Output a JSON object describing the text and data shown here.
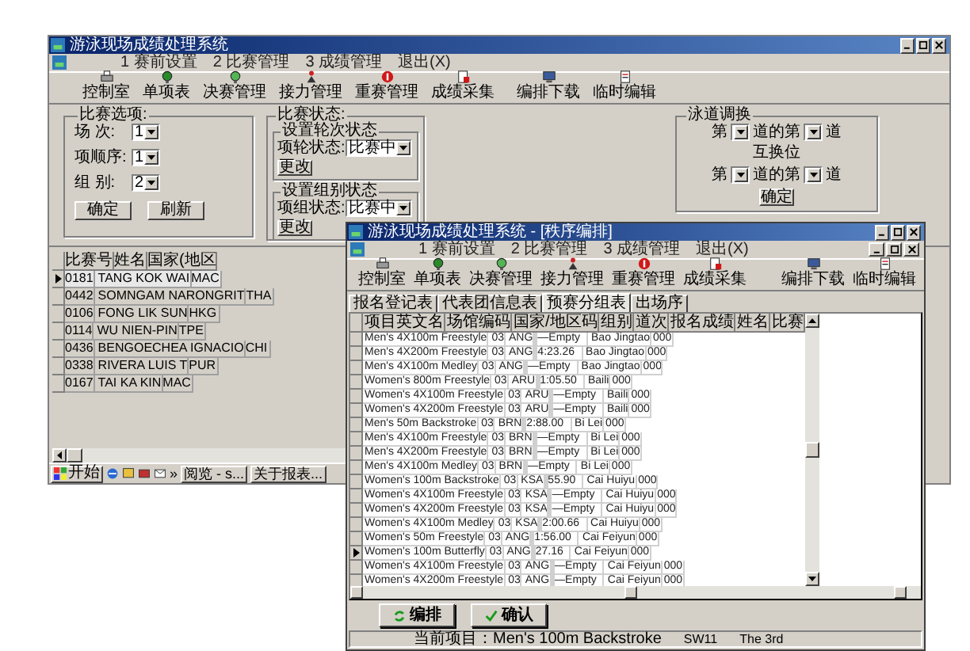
{
  "back_window": {
    "title": "游泳现场成绩处理系统",
    "menu": [
      "1 赛前设置",
      "2 比赛管理",
      "3 成绩管理",
      "退出(X)"
    ],
    "toolbar": [
      "控制室",
      "单项表",
      "决赛管理",
      "接力管理",
      "重赛管理",
      "成绩采集",
      "编排下载",
      "临时编辑"
    ],
    "match_options": {
      "legend": "比赛选项:",
      "fields": [
        {
          "label": "场 次:",
          "value": "1"
        },
        {
          "label": "项顺序:",
          "value": "1"
        },
        {
          "label": "组 别:",
          "value": "2"
        }
      ],
      "buttons": [
        "确定",
        "刷新"
      ]
    },
    "match_status": {
      "legend": "比赛状态:",
      "groups": [
        {
          "legend": "设置轮次状态",
          "label": "项轮状态:",
          "value": "比赛中",
          "button": "更改"
        },
        {
          "legend": "设置组别状态",
          "label": "项组状态:",
          "value": "比赛中",
          "button": "更改"
        }
      ]
    },
    "lane_swap": {
      "legend": "泳道调换",
      "rows": [
        {
          "prefix": "第",
          "middle": "道的第",
          "suffix": "道"
        },
        {
          "prefix": "第",
          "middle": "道的第",
          "suffix": "道"
        }
      ],
      "swap_label": "互换位",
      "button": "确定"
    },
    "table": {
      "columns": [
        "比赛号",
        "姓名",
        "国家(地区"
      ],
      "rows": [
        {
          "selected": true,
          "bib": "0181",
          "name": "TANG KOK WAI",
          "nation": "MAC"
        },
        {
          "selected": false,
          "bib": "0442",
          "name": "SOMNGAM NARONGRIT",
          "nation": "THA"
        },
        {
          "selected": false,
          "bib": "0106",
          "name": "FONG LIK SUN",
          "nation": "HKG"
        },
        {
          "selected": false,
          "bib": "0114",
          "name": "WU NIEN-PIN",
          "nation": "TPE"
        },
        {
          "selected": false,
          "bib": "0436",
          "name": "BENGOECHEA IGNACIO",
          "nation": "CHI"
        },
        {
          "selected": false,
          "bib": "0338",
          "name": "RIVERA LUIS T",
          "nation": "PUR"
        },
        {
          "selected": false,
          "bib": "0167",
          "name": "TAI KA KIN",
          "nation": "MAC"
        }
      ]
    }
  },
  "taskbar": {
    "start": "开始",
    "chevron": "»",
    "tasks": [
      "阅览 - s...",
      "关于报表..."
    ]
  },
  "front_window": {
    "title": "游泳现场成绩处理系统 - [秩序编排]",
    "menu": [
      "1 赛前设置",
      "2 比赛管理",
      "3 成绩管理",
      "退出(X)"
    ],
    "toolbar": [
      "控制室",
      "单项表",
      "决赛管理",
      "接力管理",
      "重赛管理",
      "成绩采集",
      "编排下载",
      "临时编辑"
    ],
    "tabs": [
      {
        "label": "报名登记表",
        "selected": false
      },
      {
        "label": "代表团信息表",
        "selected": false
      },
      {
        "label": "预赛分组表",
        "selected": true
      },
      {
        "label": "出场序",
        "selected": false
      }
    ],
    "table": {
      "columns": [
        "项目英文名",
        "场馆编码",
        "国家/地区码",
        "组别",
        "道次",
        "报名成绩",
        "姓名",
        "比赛"
      ],
      "rows": [
        {
          "selected": false,
          "event": "Men's 4X100m Freestyle",
          "venue": "03",
          "nation": "ANG",
          "entry": "—Empty",
          "name": "Bao Jingtao",
          "bib": "000"
        },
        {
          "selected": false,
          "event": "Men's 4X200m Freestyle",
          "venue": "03",
          "nation": "ANG",
          "entry": "4:23.26",
          "name": "Bao Jingtao",
          "bib": "000"
        },
        {
          "selected": false,
          "event": "Men's 4X100m Medley",
          "venue": "03",
          "nation": "ANG",
          "entry": "—Empty",
          "name": "Bao Jingtao",
          "bib": "000"
        },
        {
          "selected": false,
          "event": "Women's 800m Freestyle",
          "venue": "03",
          "nation": "ARU",
          "entry": "1:05.50",
          "name": "Baili",
          "bib": "000"
        },
        {
          "selected": false,
          "event": "Women's 4X100m Freestyle",
          "venue": "03",
          "nation": "ARU",
          "entry": "—Empty",
          "name": "Baili",
          "bib": "000"
        },
        {
          "selected": false,
          "event": "Women's 4X200m Freestyle",
          "venue": "03",
          "nation": "ARU",
          "entry": "—Empty",
          "name": "Baili",
          "bib": "000"
        },
        {
          "selected": false,
          "event": "Men's 50m Backstroke",
          "venue": "03",
          "nation": "BRN",
          "entry": "2:88.00",
          "name": "Bi Lei",
          "bib": "000"
        },
        {
          "selected": false,
          "event": "Men's 4X100m Freestyle",
          "venue": "03",
          "nation": "BRN",
          "entry": "—Empty",
          "name": "Bi Lei",
          "bib": "000"
        },
        {
          "selected": false,
          "event": "Men's 4X200m Freestyle",
          "venue": "03",
          "nation": "BRN",
          "entry": "—Empty",
          "name": "Bi Lei",
          "bib": "000"
        },
        {
          "selected": false,
          "event": "Men's 4X100m Medley",
          "venue": "03",
          "nation": "BRN",
          "entry": "—Empty",
          "name": "Bi Lei",
          "bib": "000"
        },
        {
          "selected": false,
          "event": "Women's 100m Backstroke",
          "venue": "03",
          "nation": "KSA",
          "entry": "55.90",
          "name": "Cai Huiyu",
          "bib": "000"
        },
        {
          "selected": false,
          "event": "Women's 4X100m Freestyle",
          "venue": "03",
          "nation": "KSA",
          "entry": "—Empty",
          "name": "Cai Huiyu",
          "bib": "000"
        },
        {
          "selected": false,
          "event": "Women's 4X200m Freestyle",
          "venue": "03",
          "nation": "KSA",
          "entry": "—Empty",
          "name": "Cai Huiyu",
          "bib": "000"
        },
        {
          "selected": false,
          "event": "Women's 4X100m Medley",
          "venue": "03",
          "nation": "KSA",
          "entry": "2:00.66",
          "name": "Cai Huiyu",
          "bib": "000"
        },
        {
          "selected": false,
          "event": "Women's 50m Freestyle",
          "venue": "03",
          "nation": "ANG",
          "entry": "1:56.00",
          "name": "Cai Feiyun",
          "bib": "000"
        },
        {
          "selected": true,
          "event": "Women's 100m Butterfly",
          "venue": "03",
          "nation": "ANG",
          "entry": "27.16",
          "name": "Cai Feiyun",
          "bib": "000"
        },
        {
          "selected": false,
          "event": "Women's 4X100m Freestyle",
          "venue": "03",
          "nation": "ANG",
          "entry": "—Empty",
          "name": "Cai Feiyun",
          "bib": "000"
        },
        {
          "selected": false,
          "event": "Women's 4X200m Freestyle",
          "venue": "03",
          "nation": "ANG",
          "entry": "—Empty",
          "name": "Cai Feiyun",
          "bib": "000"
        }
      ]
    },
    "buttons": [
      {
        "kind": "refresh",
        "label": "编排"
      },
      {
        "kind": "confirm",
        "label": "确认"
      }
    ],
    "status_bar": {
      "item": "当前项目：Men's 100m Backstroke",
      "code": "SW11",
      "round": "The 3rd"
    }
  }
}
